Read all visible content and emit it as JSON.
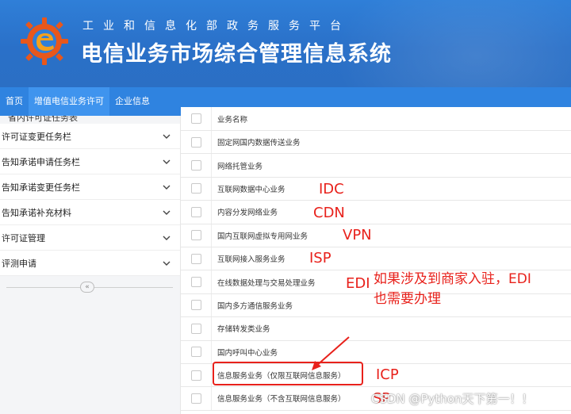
{
  "header": {
    "top_text": "工业和信息化部政务服务平台",
    "title": "电信业务市场综合管理信息系统"
  },
  "nav": {
    "items": [
      "首页",
      "增值电信业务许可",
      "企业信息"
    ],
    "active_index": 1
  },
  "sidebar": {
    "partial_item": "省内许可证任务表",
    "items": [
      {
        "label": "许可证变更任务栏"
      },
      {
        "label": "告知承诺申请任务栏"
      },
      {
        "label": "告知承诺变更任务栏"
      },
      {
        "label": "告知承诺补充材料"
      },
      {
        "label": "许可证管理"
      },
      {
        "label": "评测申请"
      }
    ],
    "collapse_symbol": "«"
  },
  "table": {
    "header": "业务名称",
    "rows": [
      "固定网国内数据传送业务",
      "网络托管业务",
      "互联网数据中心业务",
      "内容分发网络业务",
      "国内互联网虚拟专用网业务",
      "互联网接入服务业务",
      "在线数据处理与交易处理业务",
      "国内多方通信服务业务",
      "存储转发类业务",
      "国内呼叫中心业务",
      "信息服务业务（仅限互联网信息服务）",
      "信息服务业务（不含互联网信息服务）"
    ]
  },
  "annotations": {
    "idc": "IDC",
    "cdn": "CDN",
    "vpn": "VPN",
    "isp": "ISP",
    "edi": "EDI",
    "edi_note_1": "如果涉及到商家入驻，EDI",
    "edi_note_2": "也需要办理",
    "icp": "ICP",
    "sp": "SP"
  },
  "watermark": "CSDN @Python天下第一！！",
  "colors": {
    "header_blue": "#2a70c8",
    "nav_blue": "#2f83e0",
    "annotation_red": "#e8211b"
  }
}
